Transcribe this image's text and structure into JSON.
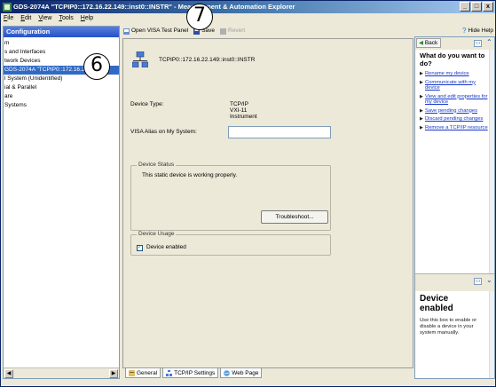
{
  "window": {
    "title": "GDS-2074A \"TCPIP0::172.16.22.149::inst0::INSTR\" - Measurement & Automation Explorer",
    "controls": [
      "_",
      "□",
      "x"
    ]
  },
  "menu": [
    "File",
    "Edit",
    "View",
    "Tools",
    "Help"
  ],
  "left_panel": {
    "header": "Configuration",
    "tree": [
      "m",
      "s and Interfaces",
      "twork Devices",
      "GDS-2074A \"TCPIP0::172.16.22.14",
      "l System (Unidentified)",
      "ial & Parallel",
      "are",
      "Systems"
    ],
    "selected_index": 3
  },
  "toolbar": {
    "open_visa": "Open VISA Test Panel",
    "save": "Save",
    "revert": "Revert"
  },
  "main": {
    "resource": "TCPIP0::172.16.22.149::inst0::INSTR",
    "device_type_label": "Device Type:",
    "device_type_value": "TCP/IP VXI-11 Instrument",
    "alias_label": "VISA Alias on My System:",
    "alias_value": "",
    "status_group": "Device Status",
    "status_text": "This static device is working properly.",
    "troubleshoot_label": "Troubleshoot...",
    "usage_group": "Device Usage",
    "device_enabled_label": "Device enabled",
    "device_enabled_checked": true
  },
  "tabs": [
    "General",
    "TCP/IP Settings",
    "Web Page"
  ],
  "help": {
    "hide_help": "Hide Help",
    "back": "Back",
    "title": "What do you want to do?",
    "links": [
      "Rename my device",
      "Communicate with my device",
      "View and edit properties for my device",
      "Save pending changes",
      "Discard pending changes",
      "Remove a TCP/IP resource"
    ],
    "bottom_title": "Device enabled",
    "bottom_text": "Use this box to enable or disable a device in your system manually."
  },
  "callouts": [
    "6",
    "7"
  ]
}
